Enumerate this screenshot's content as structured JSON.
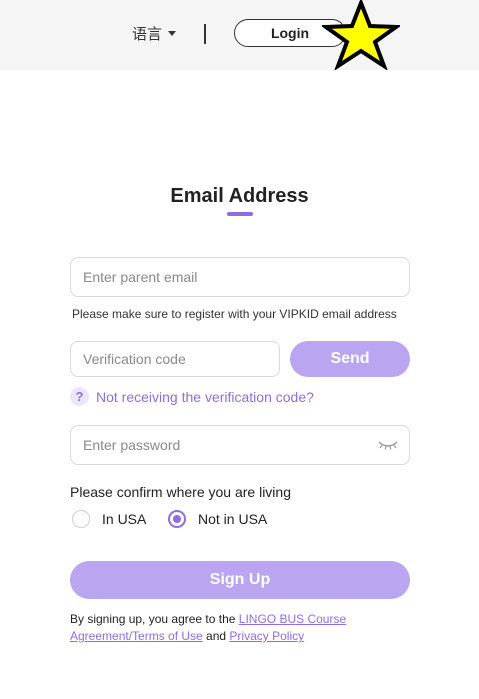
{
  "header": {
    "language_label": "语言",
    "login_label": "Login"
  },
  "form": {
    "title": "Email Address",
    "email": {
      "placeholder": "Enter parent email",
      "value": ""
    },
    "email_hint": "Please make sure to register with your VIPKID email address",
    "verification": {
      "placeholder": "Verification code",
      "value": "",
      "send_label": "Send"
    },
    "help": {
      "icon_glyph": "?",
      "link_text": "Not receiving the verification code?"
    },
    "password": {
      "placeholder": "Enter password",
      "value": ""
    },
    "living": {
      "question": "Please confirm where you are living",
      "options": [
        {
          "label": "In USA",
          "selected": false
        },
        {
          "label": "Not in USA",
          "selected": true
        }
      ]
    },
    "signup_label": "Sign Up",
    "terms": {
      "prefix": "By signing up, you agree to the ",
      "agreement_link": "LINGO BUS Course Agreement/Terms of Use",
      "conjunction": " and ",
      "privacy_link": "Privacy Policy"
    }
  },
  "icons": {
    "language_dropdown": "caret-down-icon",
    "help": "question-icon",
    "password_visibility": "eye-closed-icon",
    "annotation": "star-icon"
  },
  "colors": {
    "accent": "#8f6ce3",
    "button_disabled": "#b9a5f0",
    "topbar_bg": "#f5f5f5",
    "star_fill": "#ffff00"
  }
}
